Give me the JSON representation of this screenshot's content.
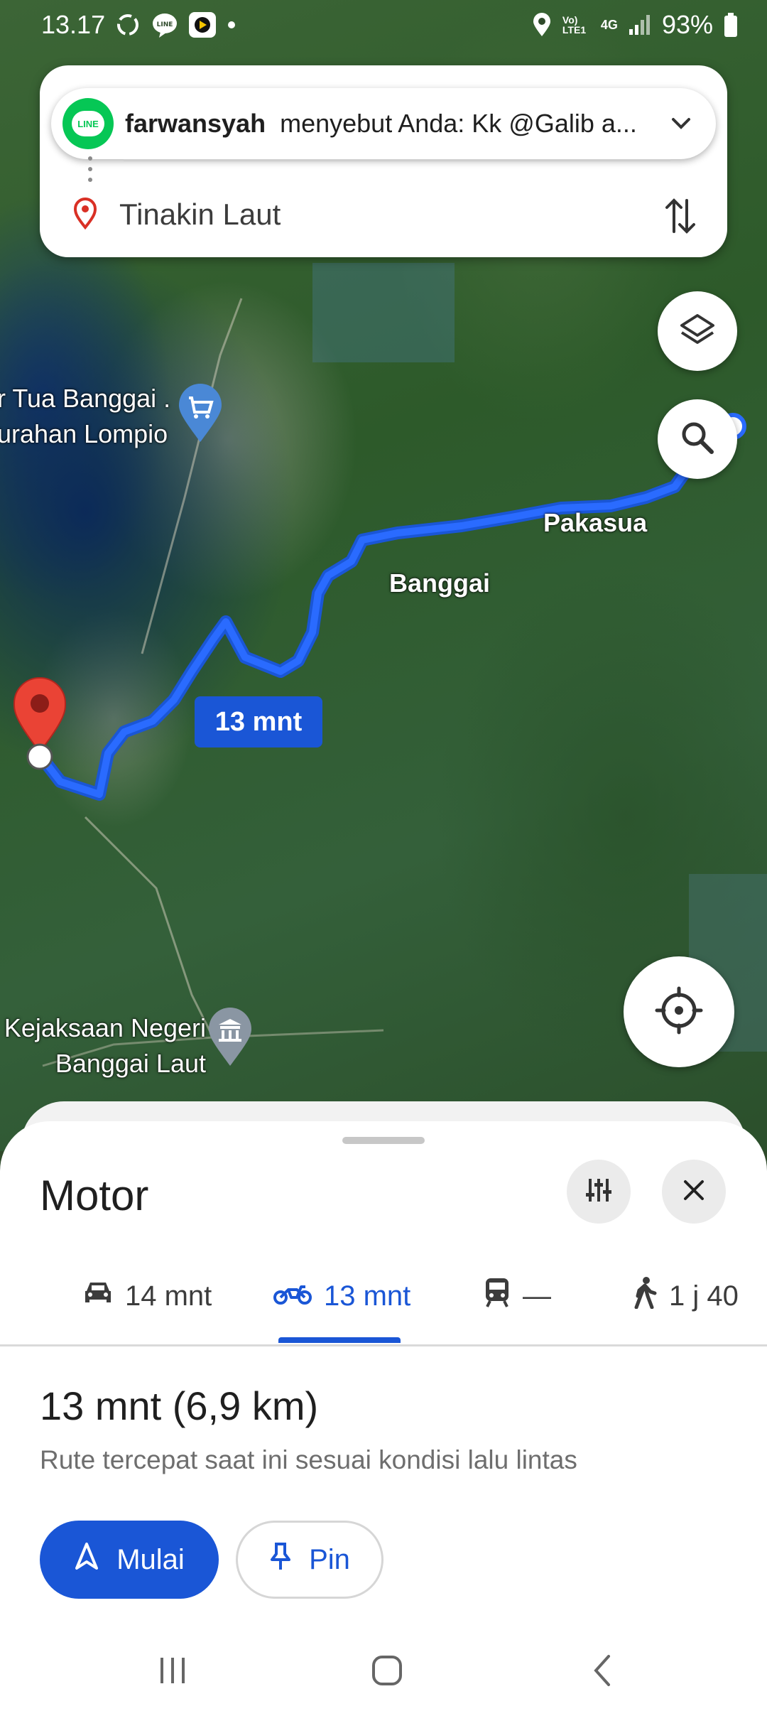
{
  "status_bar": {
    "time": "13.17",
    "battery": "93%",
    "network": "4G",
    "volte": "Vo) LTE1"
  },
  "notification": {
    "app": "LINE",
    "sender": "farwansyah",
    "message": "menyebut Anda: Kk @Galib a..."
  },
  "destination": {
    "name": "Tinakin Laut"
  },
  "map": {
    "labels": {
      "pakasua": "Pakasua",
      "banggai": "Banggai"
    },
    "poi_market": {
      "line1": "r Tua Banggai .",
      "line2": "urahan Lompio"
    },
    "poi_gov": {
      "line1": "Kejaksaan Negeri",
      "line2": "Banggai Laut"
    },
    "eta_chip": "13 mnt",
    "route_color": "#1a56d6"
  },
  "sheet": {
    "title": "Motor",
    "modes": [
      {
        "icon": "car-icon",
        "label": "14 mnt"
      },
      {
        "icon": "motorcycle-icon",
        "label": "13 mnt",
        "active": true
      },
      {
        "icon": "transit-icon",
        "label": "—"
      },
      {
        "icon": "walk-icon",
        "label": "1 j 40"
      }
    ],
    "summary": "13 mnt (6,9 km)",
    "description": "Rute tercepat saat ini sesuai kondisi lalu lintas",
    "start_label": "Mulai",
    "pin_label": "Pin"
  },
  "colors": {
    "accent": "#1a56d6",
    "line_green": "#06c755",
    "marker_red": "#ea4335"
  }
}
